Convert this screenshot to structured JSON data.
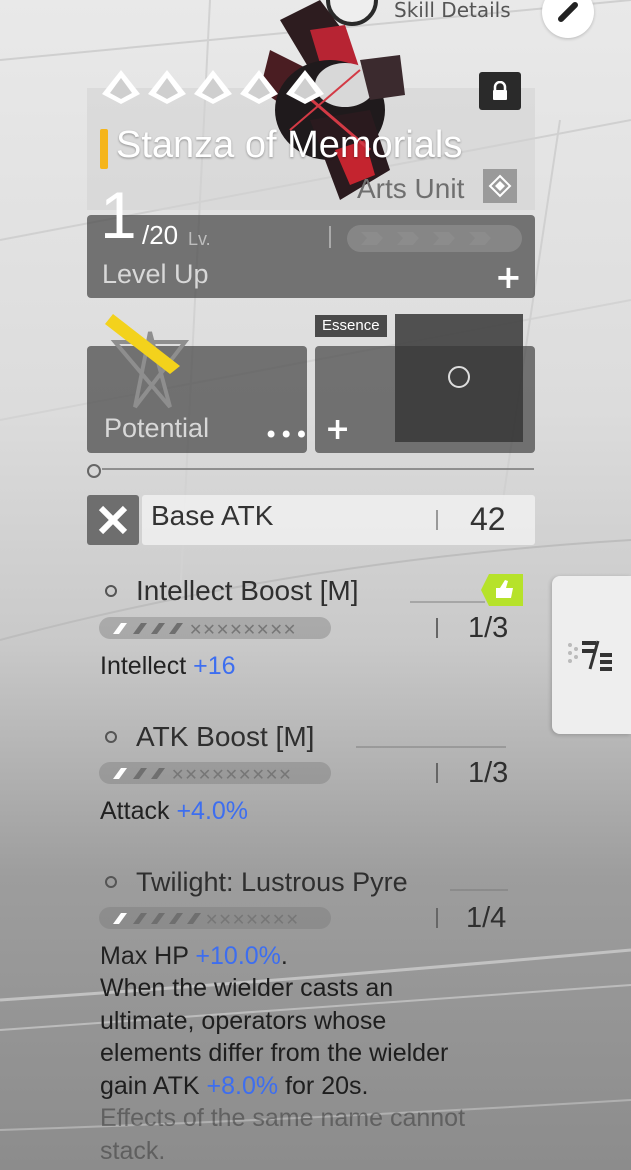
{
  "top": {
    "skill_details_label": "Skill Details"
  },
  "weapon": {
    "rarity_stars": 5,
    "name": "Stanza of Memorials",
    "type": "Arts Unit",
    "accent_color": "#f5b51a"
  },
  "level": {
    "current": "1",
    "max": "/20",
    "lv_label": "Lv.",
    "level_up_label": "Level Up"
  },
  "potential": {
    "label": "Potential"
  },
  "essence": {
    "tag": "Essence"
  },
  "base_atk": {
    "label": "Base ATK",
    "value": "42"
  },
  "skills": [
    {
      "name": "Intellect Boost [M]",
      "rank": "1/3",
      "stat_label": "Intellect",
      "stat_value": "+16"
    },
    {
      "name": "ATK Boost [M]",
      "rank": "1/3",
      "stat_label": "Attack",
      "stat_value": "+4.0%"
    },
    {
      "name": "Twilight: Lustrous Pyre",
      "rank": "1/4",
      "stat_label": "Max HP",
      "stat_value": "+10.0%",
      "stat_suffix": ".",
      "desc_line1": "When the wielder casts an",
      "desc_line2": "ultimate, operators whose",
      "desc_line3": "elements differ from the wielder",
      "desc_line4_pre": "gain ATK ",
      "desc_line4_value": "+8.0%",
      "desc_line4_post": " for 20s.",
      "desc_line5": "Effects of the same name cannot",
      "desc_line6": "stack."
    }
  ],
  "colors": {
    "stat_highlight": "#3d6ef0",
    "thumb_tag": "#b6e22a"
  },
  "icons": [
    "skill-details-icon",
    "close-icon",
    "lock-icon",
    "arts-unit-icon",
    "more-icon",
    "plus-icon",
    "base-atk-icon",
    "thumbs-up-icon",
    "list-toggle-icon"
  ]
}
